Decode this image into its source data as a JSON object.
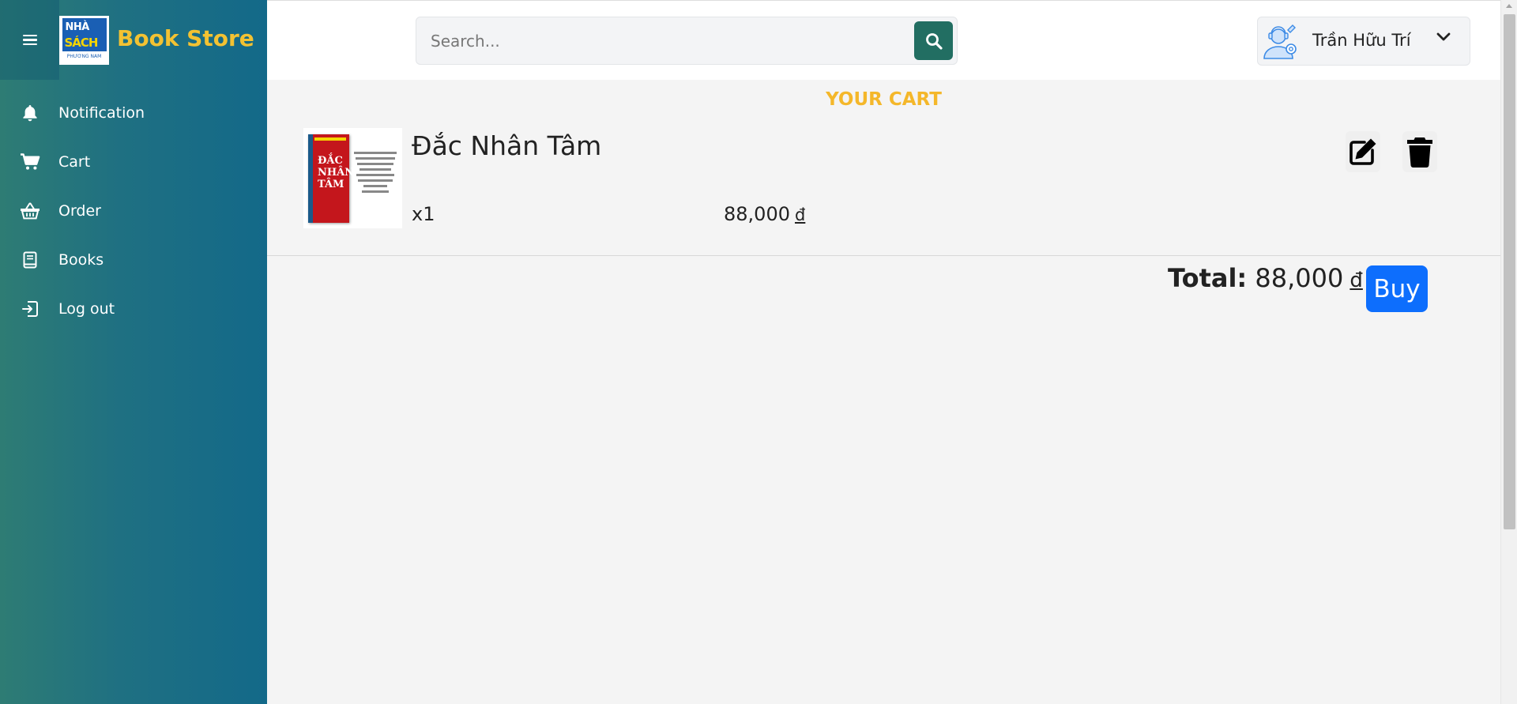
{
  "brand": {
    "logo_text_top": "NHÀ",
    "logo_text_mid": "SÁCH",
    "logo_text_bottom": "PHƯƠNG NAM",
    "name": "Book Store"
  },
  "sidebar": {
    "items": [
      {
        "label": "Notification",
        "icon": "bell-icon"
      },
      {
        "label": "Cart",
        "icon": "cart-icon"
      },
      {
        "label": "Order",
        "icon": "basket-icon"
      },
      {
        "label": "Books",
        "icon": "book-icon"
      },
      {
        "label": "Log out",
        "icon": "logout-icon"
      }
    ]
  },
  "header": {
    "search_placeholder": "Search...",
    "user_name": "Trần Hữu Trí"
  },
  "cart": {
    "title": "YOUR CART",
    "items": [
      {
        "title": "Đắc Nhân Tâm",
        "quantity": "x1",
        "price": "88,000",
        "currency": "đ",
        "cover_text": "ĐẮC NHÂN TÂM"
      }
    ],
    "total_label": "Total:",
    "total_value": "88,000",
    "total_currency": "đ",
    "buy_label": "Buy"
  },
  "colors": {
    "brand_gold": "#f3c232",
    "search_button": "#226e62",
    "buy_button": "#0d6efd",
    "cart_title": "#f4b72a"
  }
}
